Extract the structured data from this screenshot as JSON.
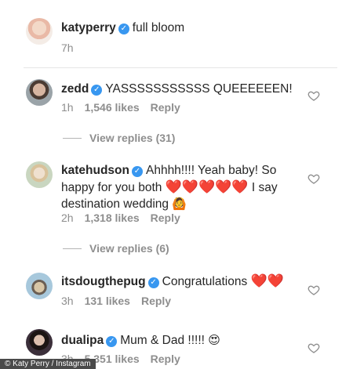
{
  "caption": {
    "username": "katyperry",
    "text": "full bloom",
    "time": "7h"
  },
  "comments": [
    {
      "username": "zedd",
      "text": "YASSSSSSSSSSS QUEEEEEEN!",
      "time": "1h",
      "likes": "1,546 likes",
      "reply": "Reply",
      "view_replies": "View replies (31)"
    },
    {
      "username": "katehudson",
      "text_part1": "Ahhhh!!!! Yeah baby! So happy for you both",
      "hearts": "❤️❤️❤️❤️❤️",
      "text_part2": "I say destination wedding",
      "emoji": "🙆",
      "time": "2h",
      "likes": "1,318 likes",
      "reply": "Reply",
      "view_replies": "View replies (6)"
    },
    {
      "username": "itsdougthepug",
      "text": "Congratulations",
      "hearts": "❤️❤️",
      "time": "3h",
      "likes": "131 likes",
      "reply": "Reply"
    },
    {
      "username": "dualipa",
      "text": "Mum & Dad !!!!!",
      "emoji": "😍",
      "time": "3h",
      "likes": "5,351 likes",
      "reply": "Reply"
    }
  ],
  "icons": {
    "verified": "verified-badge-icon",
    "like": "heart-outline-icon"
  },
  "colors": {
    "verified": "#3897f0",
    "meta_text": "#8e8e8e",
    "heart_emoji": "#e0202c"
  },
  "credit": "© Katy Perry / Instagram"
}
